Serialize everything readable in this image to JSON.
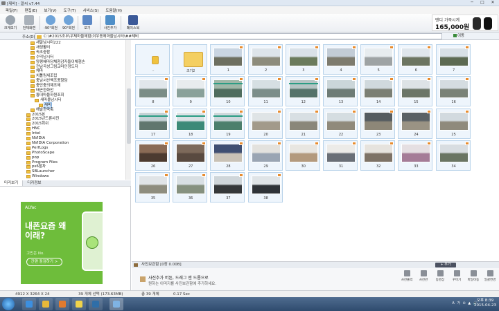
{
  "window": {
    "title": "[제비] - 알씨 v7.44",
    "controls": [
      "─",
      "□",
      "✕"
    ]
  },
  "menu": [
    "파일(F)",
    "편집(E)",
    "보기(V)",
    "도구(T)",
    "서비스(S)",
    "도움말(H)"
  ],
  "toolbar": [
    {
      "label": "크게보기",
      "icon": "zoom-icon",
      "color": "#9aa4ae",
      "name": "toolbar-enlarge-button"
    },
    {
      "label": "전체화면",
      "icon": "fullscreen-icon",
      "color": "#a9b1ba",
      "name": "toolbar-fullscreen-button"
    },
    {
      "label": "-90°회전",
      "icon": "rotate-left-icon",
      "color": "#6fa4d9",
      "name": "toolbar-rotate-left-button"
    },
    {
      "label": "90°회전",
      "icon": "rotate-right-icon",
      "color": "#6fa4d9",
      "name": "toolbar-rotate-right-button"
    },
    {
      "label": "보기",
      "icon": "view-icon",
      "color": "#5c88c5",
      "name": "toolbar-view-button"
    },
    {
      "label": "사진추가",
      "icon": "add-photo-icon",
      "color": "#4f8fc8",
      "name": "toolbar-add-photo-button"
    },
    {
      "label": "페이스북",
      "icon": "facebook-icon",
      "color": "#3b5998",
      "name": "toolbar-facebook-button"
    }
  ],
  "ad": {
    "line1": "탠디 가죽시계",
    "price": "165,000원"
  },
  "address": {
    "label": "주소(D)",
    "path": "C:\\#2015조부\\우체마을체험\\이우동체마을남시터\\##제비",
    "go": "이동"
  },
  "tree": [
    {
      "label": "새말남시터222",
      "indent": 1
    },
    {
      "label": "새생활터",
      "indent": 1
    },
    {
      "label": "속초중합",
      "indent": 1
    },
    {
      "label": "수덕남시터",
      "indent": 1
    },
    {
      "label": "양평혜마당체험감자들이체험손",
      "indent": 1
    },
    {
      "label": "전남곡성그림교마인정도자",
      "indent": 1
    },
    {
      "label": "체마",
      "indent": 1
    },
    {
      "label": "치톨림세조립",
      "indent": 1
    },
    {
      "label": "충남서산백조종항담",
      "indent": 1
    },
    {
      "label": "충단충의제조체",
      "indent": 1
    },
    {
      "label": "태곤한화안",
      "indent": 1
    },
    {
      "label": "퉁대마을하원조회",
      "indent": 1
    },
    {
      "label": "새마을남시터",
      "indent": 2
    },
    {
      "label": "제비",
      "indent": 3,
      "selected": true
    },
    {
      "label": "해발한국축",
      "indent": 1
    },
    {
      "label": "2015본",
      "indent": 0
    },
    {
      "label": "2015년드론사진",
      "indent": 0
    },
    {
      "label": "2015회쉬",
      "indent": 0
    },
    {
      "label": "HNC",
      "indent": 0
    },
    {
      "label": "Intel",
      "indent": 0
    },
    {
      "label": "NVIDIA",
      "indent": 0
    },
    {
      "label": "NVIDIA Corporation",
      "indent": 0
    },
    {
      "label": "PerfLogs",
      "indent": 0
    },
    {
      "label": "PhotoScape",
      "indent": 0
    },
    {
      "label": "pop",
      "indent": 0
    },
    {
      "label": "Program Files",
      "indent": 0
    },
    {
      "label": "ps6할차",
      "indent": 0
    },
    {
      "label": "SBLauncher",
      "indent": 0
    },
    {
      "label": "Windows",
      "indent": 0
    }
  ],
  "preview_tabs": [
    "미리보기",
    "디카정보"
  ],
  "banner": {
    "brand": "ALYac",
    "headline": "내폰요즘 왜이래?",
    "sub": "고민은 No.",
    "button": "간편 점검하기 >"
  },
  "thumbs": [
    {
      "cap": "..",
      "kind": "up"
    },
    {
      "cap": "크기2",
      "kind": "folder"
    },
    {
      "cap": "1",
      "top": "#c9d5e2",
      "bot": "#6d6f60"
    },
    {
      "cap": "2",
      "top": "#dde4ea",
      "bot": "#8d8c7c"
    },
    {
      "cap": "3",
      "top": "#d9e1e8",
      "bot": "#6b7b5c"
    },
    {
      "cap": "4",
      "top": "#c2ccd6",
      "bot": "#7d7b6e"
    },
    {
      "cap": "5",
      "top": "#e7ecef",
      "bot": "#9ea3a4"
    },
    {
      "cap": "6",
      "top": "#dfe6ec",
      "bot": "#6c7561"
    },
    {
      "cap": "7",
      "top": "#d8e0e6",
      "bot": "#5d6a52"
    },
    {
      "cap": "8",
      "top": "#e1e7eb",
      "bot": "#7b8d86"
    },
    {
      "cap": "9",
      "top": "#e8ecee",
      "bot": "#8aa19a"
    },
    {
      "cap": "10",
      "top": "#9fb7a8",
      "bot": "#4f6d5f",
      "teal": true
    },
    {
      "cap": "11",
      "top": "#d6dfe3",
      "bot": "#7c8e8a"
    },
    {
      "cap": "12",
      "top": "#b5c4c4",
      "bot": "#55736a",
      "teal": true
    },
    {
      "cap": "13",
      "top": "#cbd6d9",
      "bot": "#6e7c76"
    },
    {
      "cap": "14",
      "top": "#d0d9dd",
      "bot": "#7b7f74"
    },
    {
      "cap": "15",
      "top": "#dde3e6",
      "bot": "#6c7668"
    },
    {
      "cap": "16",
      "top": "#d4dce1",
      "bot": "#7a8277"
    },
    {
      "cap": "17",
      "top": "#c5d2d6",
      "bot": "#60766e",
      "teal": true
    },
    {
      "cap": "18",
      "top": "#dde3e6",
      "bot": "#3c8a78",
      "teal": true
    },
    {
      "cap": "19",
      "top": "#cfd8dc",
      "bot": "#4c7f6c",
      "teal": true
    },
    {
      "cap": "20",
      "top": "#dfe4e6",
      "bot": "#a29a8a"
    },
    {
      "cap": "21",
      "top": "#d8dfe3",
      "bot": "#8a877a"
    },
    {
      "cap": "22",
      "top": "#d5dde1",
      "bot": "#908a7b"
    },
    {
      "cap": "23",
      "top": "#555c60",
      "bot": "#8d8778"
    },
    {
      "cap": "24",
      "top": "#5a6165",
      "bot": "#9a9384"
    },
    {
      "cap": "25",
      "top": "#d2dadf",
      "bot": "#8f8a7c"
    },
    {
      "cap": "26",
      "top": "#8a6b55",
      "bot": "#4c3b30"
    },
    {
      "cap": "27",
      "top": "#7d6a5b",
      "bot": "#594a40"
    },
    {
      "cap": "28",
      "top": "#3f4f72",
      "bot": "#c9c2b6"
    },
    {
      "cap": "29",
      "top": "#e3e2de",
      "bot": "#9aa5b3"
    },
    {
      "cap": "30",
      "top": "#e8e6e1",
      "bot": "#b39a7e"
    },
    {
      "cap": "31",
      "top": "#ecebe8",
      "bot": "#6a6f77"
    },
    {
      "cap": "32",
      "top": "#e6e3de",
      "bot": "#7d7266"
    },
    {
      "cap": "33",
      "top": "#e5dfe2",
      "bot": "#a57c97"
    },
    {
      "cap": "34",
      "top": "#d8dde1",
      "bot": "#6a7563"
    },
    {
      "cap": "35",
      "top": "#e0e4e7",
      "bot": "#8e8d7e"
    },
    {
      "cap": "36",
      "top": "#d8dfe3",
      "bot": "#86917f"
    },
    {
      "cap": "37",
      "top": "#cfd6da",
      "bot": "#35383a"
    },
    {
      "cap": "38",
      "top": "#dfe4e7",
      "bot": "#2f3338"
    }
  ],
  "holder": {
    "title": "사진보관함",
    "count": "[0장 0.00B]",
    "add": "+ 추가",
    "msg1": "사진추가 버튼, 드래그 앤 드롭으로",
    "msg2": "원하는 이미지를 사진보관함에 추가하세요."
  },
  "actions": [
    "사진출력",
    "사진관",
    "동영상",
    "꾸미기",
    "파일이동",
    "일괄변경"
  ],
  "status": {
    "dims": "4912 X 3264 X 24",
    "selection": "39 개체 선택 (173.63MB)",
    "total": "총 39 개체",
    "time": "0.17 Sec"
  },
  "tray": {
    "text": "A 가 ⊙ ▲ 🔊",
    "time": "오후 8:39",
    "date": "2015-04-23"
  }
}
